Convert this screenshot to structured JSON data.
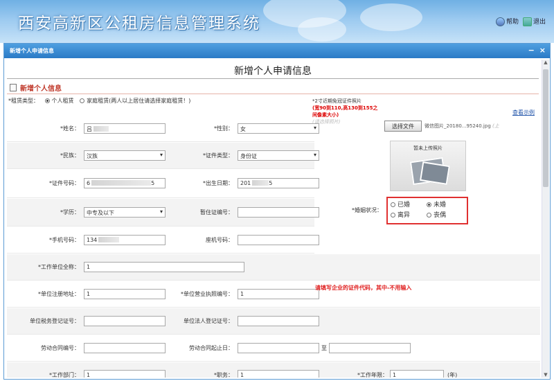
{
  "app": {
    "title": "西安高新区公租房信息管理系统",
    "help_label": "帮助",
    "exit_label": "退出"
  },
  "window": {
    "title": "新增个人申请信息"
  },
  "form": {
    "heading": "新增个人申请信息",
    "section_title": "新增个人信息",
    "sample_link": "查看示例",
    "lease_type": {
      "label": "*租赁类型：",
      "options": [
        "个人租赁",
        "家庭租赁(两人以上居住请选择家庭租赁！)"
      ],
      "selected": "个人租赁"
    },
    "fields": {
      "name": {
        "label": "*姓名：",
        "value": "吕"
      },
      "gender": {
        "label": "*性别：",
        "value": "女"
      },
      "ethnicity": {
        "label": "*民族：",
        "value": "汉族"
      },
      "id_type": {
        "label": "*证件类型：",
        "value": "身份证"
      },
      "id_number": {
        "label": "*证件号码：",
        "value": "6",
        "value_tail": "5"
      },
      "birth_date": {
        "label": "*出生日期：",
        "value": "201",
        "value_tail": "5"
      },
      "education": {
        "label": "*学历：",
        "value": "中专及以下"
      },
      "residence_permit": {
        "label": "暂住证编号：",
        "value": ""
      },
      "marital_status": {
        "label": "*婚姻状况：",
        "options": [
          "已婚",
          "未婚",
          "离异",
          "丧偶"
        ],
        "selected": "未婚"
      },
      "mobile": {
        "label": "*手机号码：",
        "value": "134"
      },
      "landline": {
        "label": "座机号码：",
        "value": ""
      },
      "employer": {
        "label": "*工作单位全称：",
        "value": "1"
      },
      "employer_address": {
        "label": "*单位注册地址：",
        "value": "1"
      },
      "business_license": {
        "label": "*单位营业执照编号：",
        "value": "1"
      },
      "tax_reg": {
        "label": "单位税务登记证号：",
        "value": ""
      },
      "legal_rep_reg": {
        "label": "单位法人登记证号：",
        "value": ""
      },
      "contract_no": {
        "label": "劳动合同编号：",
        "value": ""
      },
      "contract_period": {
        "label": "劳动合同起止日：",
        "value": "",
        "separator": "至",
        "end_value": ""
      },
      "department": {
        "label": "*工作部门：",
        "value": "1"
      },
      "position": {
        "label": "*职务：",
        "value": "1"
      },
      "work_years": {
        "label": "*工作年限：",
        "value": "1",
        "unit": "(年)"
      }
    },
    "photo": {
      "note_line1": "*2寸近期免冠证件照片",
      "note_red": "(宽90到110,高130到155之间像素大小)",
      "hint": "(请选择照片)",
      "choose_button": "选择文件",
      "file_name": "微信图片_20180...95240.jpg",
      "file_suffix": "(上",
      "placeholder_caption": "暂未上传照片"
    },
    "license_note": "请填写企业的证件代码，其中-不用输入"
  }
}
